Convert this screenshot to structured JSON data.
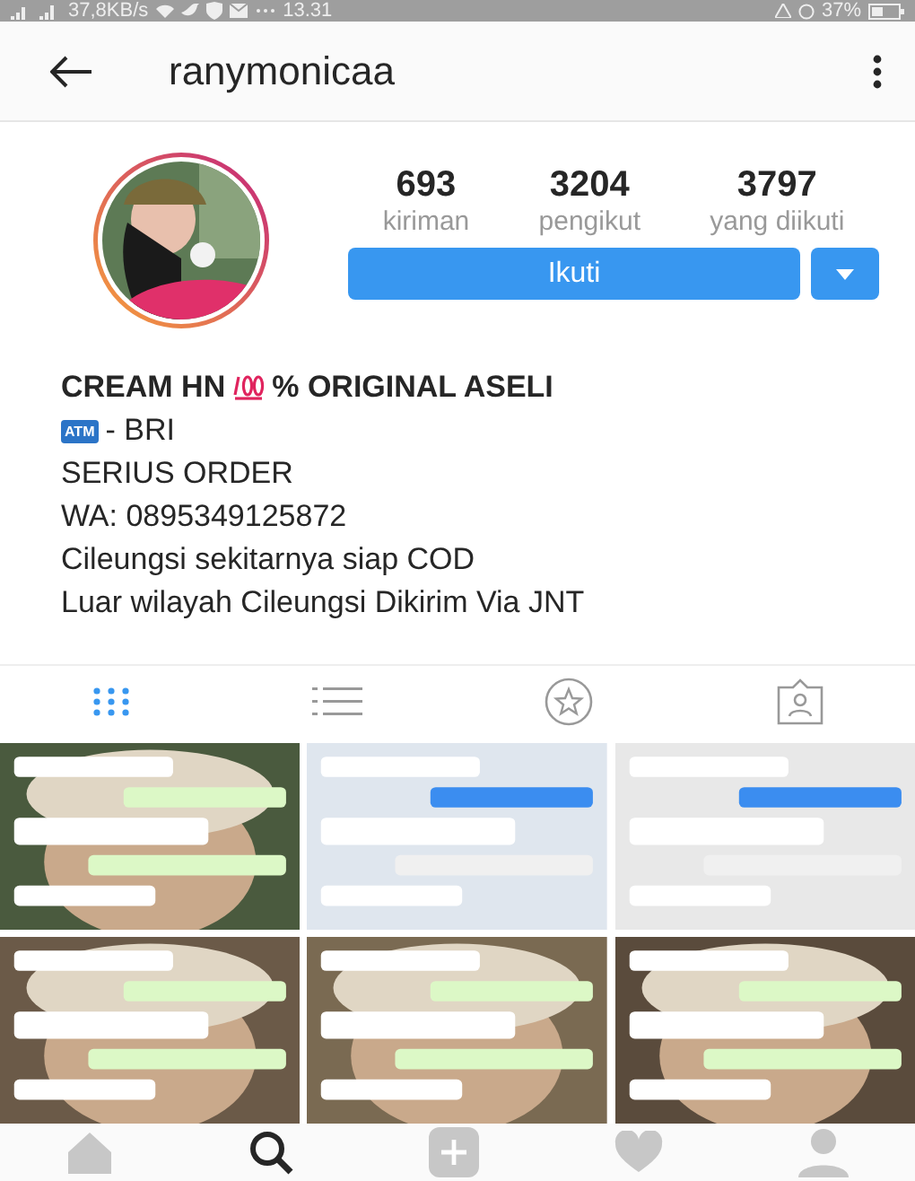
{
  "status_bar": {
    "speed": "37,8KB/s",
    "time": "13.31",
    "battery": "37%"
  },
  "top_bar": {
    "title": "ranymonicaa"
  },
  "profile": {
    "stats": [
      {
        "value": "693",
        "label": "kiriman"
      },
      {
        "value": "3204",
        "label": "pengikut"
      },
      {
        "value": "3797",
        "label": "yang diikuti"
      }
    ],
    "follow_button": "Ikuti"
  },
  "bio": {
    "headline_start": "CREAM HN",
    "headline_end": "% ORIGINAL ASELI",
    "atm_badge": "ATM",
    "bank": "- BRI",
    "lines": [
      "SERIUS ORDER",
      "WA: 0895349125872",
      "Cileungsi sekitarnya siap COD",
      "Luar wilayah Cileungsi Dikirim Via JNT"
    ]
  },
  "tabs": [
    {
      "kind": "grid",
      "selected": true
    },
    {
      "kind": "list",
      "selected": false
    },
    {
      "kind": "star",
      "selected": false
    },
    {
      "kind": "tagged",
      "selected": false
    }
  ],
  "bottom_nav": [
    {
      "kind": "home",
      "selected": false
    },
    {
      "kind": "search",
      "selected": true
    },
    {
      "kind": "add",
      "selected": false
    },
    {
      "kind": "heart",
      "selected": false
    },
    {
      "kind": "profile",
      "selected": false
    }
  ]
}
